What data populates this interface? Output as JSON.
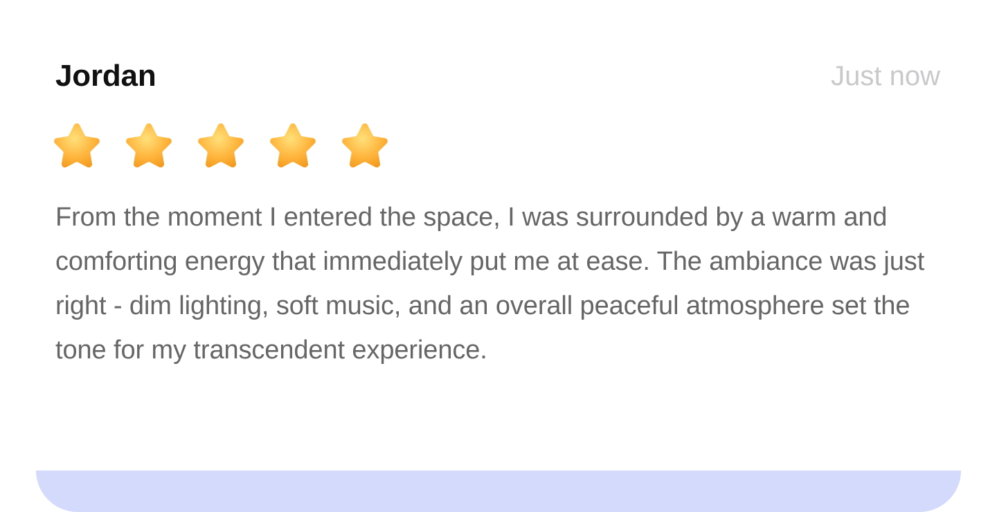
{
  "review": {
    "name": "Jordan",
    "timestamp": "Just now",
    "rating": 5,
    "rating_max": 5,
    "stars": [
      {
        "icon": "star-icon"
      },
      {
        "icon": "star-icon"
      },
      {
        "icon": "star-icon"
      },
      {
        "icon": "star-icon"
      },
      {
        "icon": "star-icon"
      }
    ],
    "text": "From the moment I entered the space, I was surrounded by a warm and comforting energy that immediately put me at ease. The ambiance was just right - dim lighting, soft music, and an overall peaceful atmosphere set the tone for my transcendent experience."
  },
  "colors": {
    "name": "#111111",
    "timestamp": "#c9c9cc",
    "body_text": "#666666",
    "star_fill": "#ffb53d",
    "bottom_bar": "#d4dafb"
  }
}
